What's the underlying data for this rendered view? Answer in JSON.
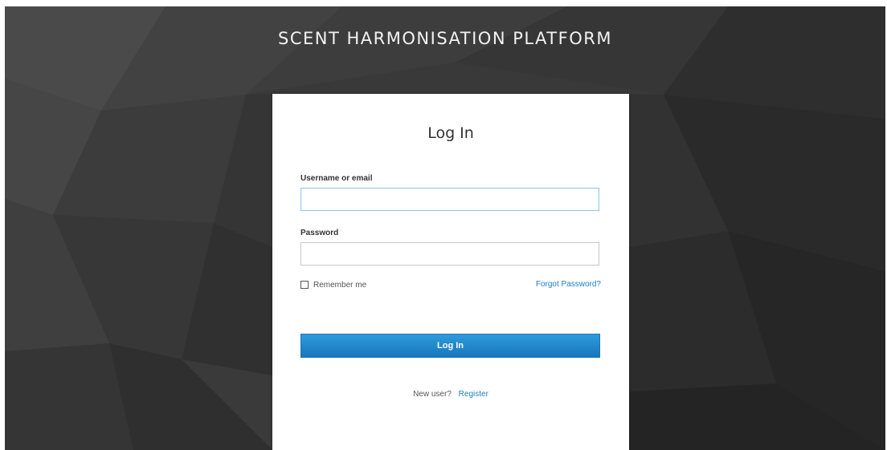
{
  "header": {
    "platform_title": "SCENT HARMONISATION PLATFORM"
  },
  "login": {
    "title": "Log In",
    "username_label": "Username or email",
    "username_value": "",
    "password_label": "Password",
    "password_value": "",
    "remember_label": "Remember me",
    "remember_checked": false,
    "forgot_label": "Forgot Password?",
    "submit_label": "Log In",
    "new_user_text": "New user?",
    "register_label": "Register"
  },
  "colors": {
    "background": "#3a3a3a",
    "card": "#ffffff",
    "accent": "#1f7fc4",
    "button": "#1e88cf",
    "title_text": "#f2f2f2"
  },
  "icons": {
    "checkbox": "empty-checkbox-icon"
  }
}
